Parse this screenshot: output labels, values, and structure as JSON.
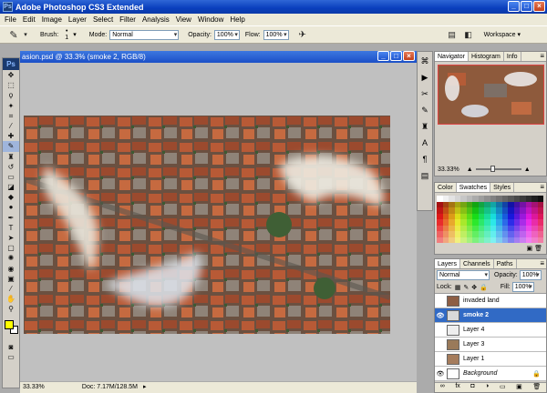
{
  "app": {
    "title": "Adobe Photoshop CS3 Extended",
    "logo": "Ps"
  },
  "window_buttons": [
    "_",
    "□",
    "×"
  ],
  "menu": [
    "File",
    "Edit",
    "Image",
    "Layer",
    "Select",
    "Filter",
    "Analysis",
    "View",
    "Window",
    "Help"
  ],
  "options": {
    "brush_label": "Brush:",
    "brush_size": "1",
    "mode_label": "Mode:",
    "mode_value": "Normal",
    "opacity_label": "Opacity:",
    "opacity_value": "100%",
    "flow_label": "Flow:",
    "flow_value": "100%",
    "workspace_label": "Workspace"
  },
  "document": {
    "title": "asion.psd @ 33.3% (smoke 2, RGB/8)",
    "status_zoom": "33.33%",
    "status_doc": "Doc: 7.17M/128.5M"
  },
  "navigator": {
    "tabs": [
      "Navigator",
      "Histogram",
      "Info"
    ],
    "zoom": "33.33%"
  },
  "swatches": {
    "tabs": [
      "Color",
      "Swatches",
      "Styles"
    ]
  },
  "layers": {
    "tabs": [
      "Layers",
      "Channels",
      "Paths"
    ],
    "blend_mode": "Normal",
    "opacity_label": "Opacity:",
    "opacity_value": "100%",
    "lock_label": "Lock:",
    "fill_label": "Fill:",
    "fill_value": "100%",
    "items": [
      {
        "name": "invaded land",
        "visible": false,
        "selected": false
      },
      {
        "name": "smoke 2",
        "visible": true,
        "selected": true
      },
      {
        "name": "Layer 4",
        "visible": false,
        "selected": false
      },
      {
        "name": "Layer 3",
        "visible": false,
        "selected": false
      },
      {
        "name": "Layer 1",
        "visible": false,
        "selected": false
      },
      {
        "name": "Background",
        "visible": true,
        "selected": false
      }
    ]
  },
  "colors": {
    "foreground": "#ffff00",
    "background": "#ffffff",
    "title_blue": "#0a3fbd",
    "selection": "#316ac5"
  }
}
